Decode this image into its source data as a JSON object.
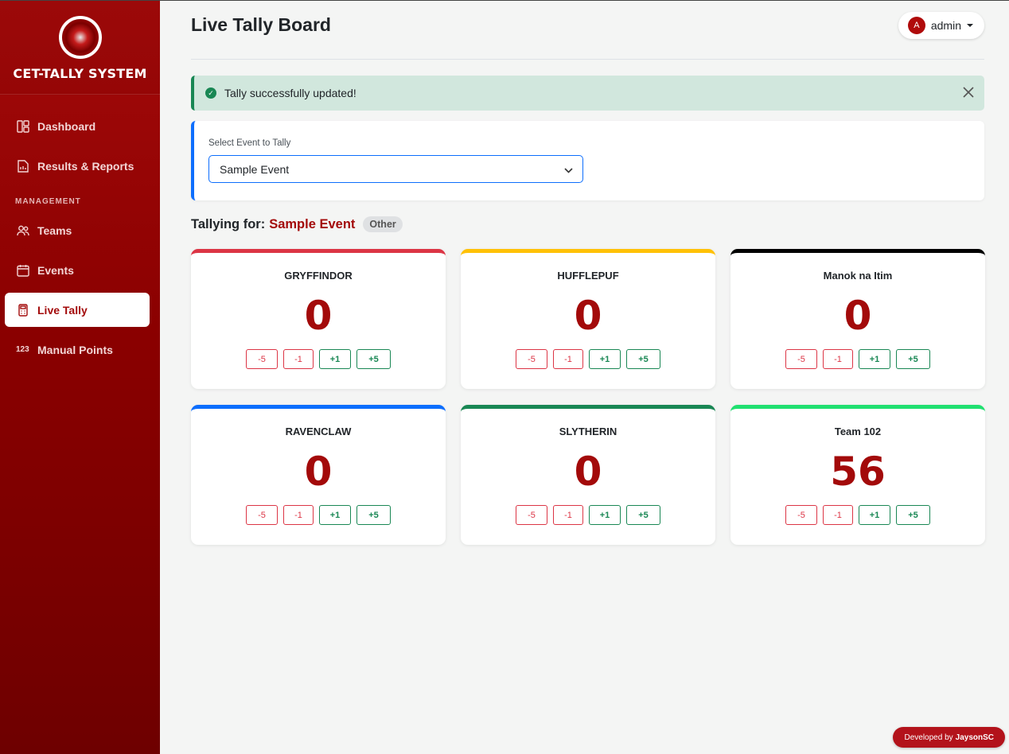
{
  "brand": {
    "name": "CET-TALLY SYSTEM"
  },
  "sidebar": {
    "items": [
      {
        "label": "Dashboard",
        "icon": "dashboard-icon"
      },
      {
        "label": "Results & Reports",
        "icon": "report-icon"
      }
    ],
    "section_label": "MANAGEMENT",
    "management_items": [
      {
        "label": "Teams",
        "icon": "users-icon"
      },
      {
        "label": "Events",
        "icon": "calendar-icon"
      },
      {
        "label": "Live Tally",
        "icon": "calculator-icon",
        "active": true
      },
      {
        "label": "Manual Points",
        "icon": "numbers-icon",
        "icon_text": "123"
      }
    ]
  },
  "header": {
    "title": "Live Tally Board",
    "user": {
      "initial": "A",
      "name": "admin"
    }
  },
  "alert": {
    "message": "Tally successfully updated!",
    "type": "success"
  },
  "event_select": {
    "label": "Select Event to Tally",
    "selected": "Sample Event"
  },
  "tallying": {
    "prefix": "Tallying for:",
    "event": "Sample Event",
    "category": "Other"
  },
  "buttons": {
    "minus5": "-5",
    "minus1": "-1",
    "plus1": "+1",
    "plus5": "+5"
  },
  "teams": [
    {
      "name": "GRYFFINDOR",
      "score": "0",
      "color": "#dc3545"
    },
    {
      "name": "HUFFLEPUF",
      "score": "0",
      "color": "#ffc107"
    },
    {
      "name": "Manok na Itim",
      "score": "0",
      "color": "#000000"
    },
    {
      "name": "RAVENCLAW",
      "score": "0",
      "color": "#0d6efd"
    },
    {
      "name": "SLYTHERIN",
      "score": "0",
      "color": "#198754"
    },
    {
      "name": "Team 102",
      "score": "56",
      "color": "#20e070"
    }
  ],
  "footer": {
    "developed_by": "Developed by",
    "developer": "JaysonSC"
  }
}
